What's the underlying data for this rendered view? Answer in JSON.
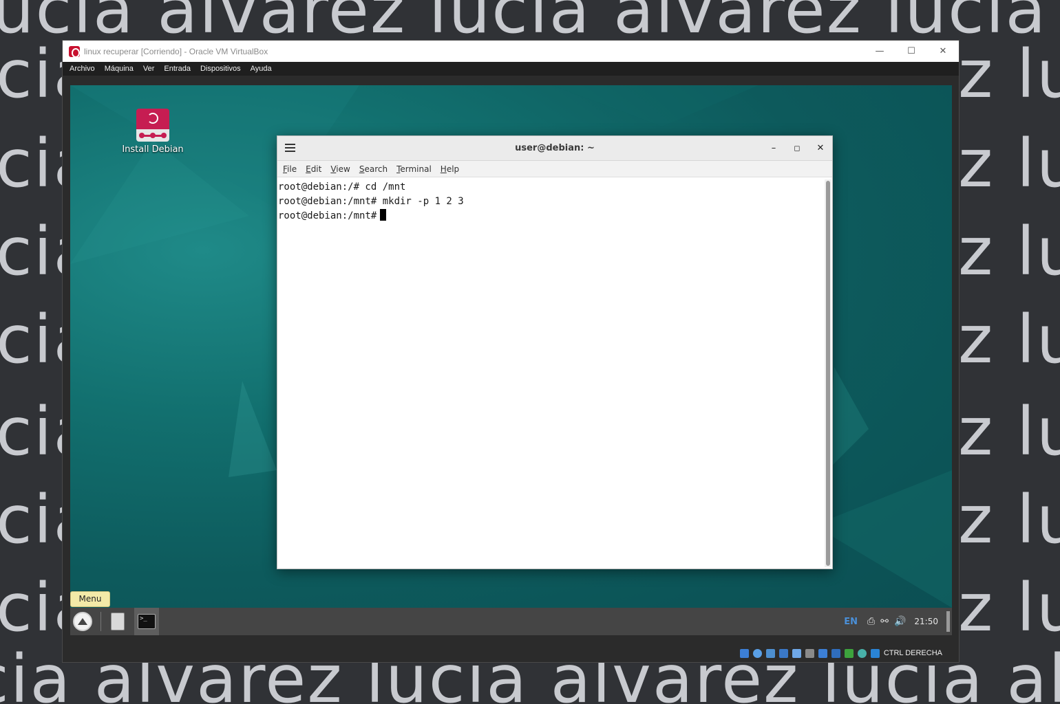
{
  "watermark": {
    "top": "lucia alvarez lucia alvarez lucia alvarez lu",
    "side_left": "cia",
    "side_right": "z luc",
    "bottom": "cia alvarez lucia alvarez lucia alvarez lu"
  },
  "vbox": {
    "title": "linux recuperar [Corriendo] - Oracle VM VirtualBox",
    "menu": [
      "Archivo",
      "Máquina",
      "Ver",
      "Entrada",
      "Dispositivos",
      "Ayuda"
    ],
    "minimize_glyph": "—",
    "maximize_glyph": "☐",
    "close_glyph": "✕",
    "host_key": "CTRL DERECHA"
  },
  "desktop": {
    "icon_label": "Install Debian"
  },
  "terminal": {
    "title": "user@debian: ~",
    "menu": [
      "File",
      "Edit",
      "View",
      "Search",
      "Terminal",
      "Help"
    ],
    "lines": [
      "root@debian:/# cd /mnt",
      "root@debian:/mnt# mkdir -p 1 2 3",
      "root@debian:/mnt#"
    ]
  },
  "panel": {
    "menu_tooltip": "Menu",
    "keyboard_layout": "EN",
    "clock": "21:50"
  },
  "colors": {
    "desktop_teal": "#0d5a5c",
    "debian_red": "#c61d52",
    "tooltip_yellow": "#f3eaa8"
  }
}
